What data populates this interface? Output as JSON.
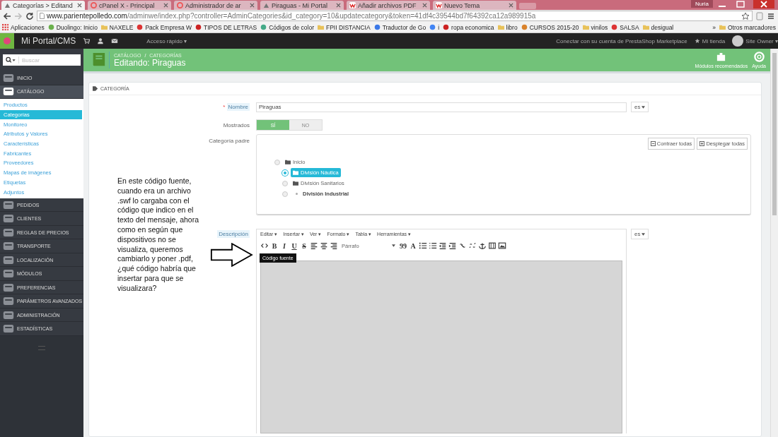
{
  "browser": {
    "tabs": [
      {
        "title": "Categorías > Editand",
        "selected": true,
        "kind": "store"
      },
      {
        "title": "cPanel X - Principal",
        "selected": false,
        "kind": "cpanel"
      },
      {
        "title": "Administrador de ar",
        "selected": false,
        "kind": "cpanel"
      },
      {
        "title": "Piraguas - Mi Portal",
        "selected": false,
        "kind": "store"
      },
      {
        "title": "Añadir archivos PDF",
        "selected": false,
        "kind": "w"
      },
      {
        "title": "Nuevo Tema",
        "selected": false,
        "kind": "w"
      }
    ],
    "user": "Nuria",
    "url_host": "www.parientepolledo.com",
    "url_path": "/adminwe/index.php?controller=AdminCategories&id_category=10&updatecategory&token=41df4c39544bd7f64392ca12a989915a",
    "bookmarks": [
      {
        "label": "Aplicaciones",
        "kind": "apps"
      },
      {
        "label": "Duolingo: Inicio",
        "kind": "green"
      },
      {
        "label": "NAXELE",
        "kind": "folder"
      },
      {
        "label": "Pack Empresa W",
        "kind": "w"
      },
      {
        "label": "TIPOS DE LETRAS",
        "kind": "red"
      },
      {
        "label": "Códigos de color",
        "kind": "wheel"
      },
      {
        "label": "FPII DISTANCIA",
        "kind": "folder"
      },
      {
        "label": "Traductor de Go",
        "kind": "blue"
      },
      {
        "label": "i",
        "kind": "g"
      },
      {
        "label": "ropa economica",
        "kind": "red"
      },
      {
        "label": "libro",
        "kind": "folder"
      },
      {
        "label": "CURSOS 2015-20",
        "kind": "orange"
      },
      {
        "label": "vinilos",
        "kind": "folder"
      },
      {
        "label": "SALSA",
        "kind": "w"
      },
      {
        "label": "desigual",
        "kind": "folder"
      }
    ],
    "more": "»",
    "other": "Otros marcadores"
  },
  "topbar": {
    "brand": "Mi Portal/CMS",
    "quick_access": "Acceso rápido ▾",
    "marketplace": "Conectar con su cuenta de PrestaShop Marketplace",
    "shop": "Mi tienda",
    "owner": "Site Owner ▾"
  },
  "sidebar": {
    "search_placeholder": "Buscar",
    "items": [
      {
        "label": "INICIO",
        "selected": false
      },
      {
        "label": "CATÁLOGO",
        "selected": true,
        "expanded": true,
        "children": [
          {
            "label": "Productos",
            "selected": false
          },
          {
            "label": "Categorías",
            "selected": true
          },
          {
            "label": "Monitoreo",
            "selected": false
          },
          {
            "label": "Atributos y Valores",
            "selected": false
          },
          {
            "label": "Características",
            "selected": false
          },
          {
            "label": "Fabricantes",
            "selected": false
          },
          {
            "label": "Proveedores",
            "selected": false
          },
          {
            "label": "Mapas de imágenes",
            "selected": false
          },
          {
            "label": "Etiquetas",
            "selected": false
          },
          {
            "label": "Adjuntos",
            "selected": false
          }
        ]
      },
      {
        "label": "PEDIDOS",
        "selected": false
      },
      {
        "label": "CLIENTES",
        "selected": false
      },
      {
        "label": "REGLAS DE PRECIOS",
        "selected": false
      },
      {
        "label": "TRANSPORTE",
        "selected": false
      },
      {
        "label": "LOCALIZACIÓN",
        "selected": false
      },
      {
        "label": "MÓDULOS",
        "selected": false
      },
      {
        "label": "PREFERENCIAS",
        "selected": false
      },
      {
        "label": "PARÁMETROS AVANZADOS",
        "selected": false
      },
      {
        "label": "ADMINISTRACIÓN",
        "selected": false
      },
      {
        "label": "ESTADÍSTICAS",
        "selected": false
      }
    ]
  },
  "header": {
    "breadcrumb": [
      "CATÁLOGO",
      "CATEGORÍAS"
    ],
    "separator": "/",
    "title": "Editando: Piraguas",
    "actions": [
      "Módulos recomendados",
      "Ayuda"
    ]
  },
  "panel": {
    "heading": "CATEGORÍA",
    "name": {
      "required_mark": "*",
      "label": "Nombre",
      "value": "Piraguas",
      "lang": "es"
    },
    "displayed": {
      "label": "Mostrados",
      "options": [
        {
          "label": "SÍ",
          "selected": true
        },
        {
          "label": "NO",
          "selected": false
        }
      ]
    },
    "parent": {
      "label": "Categoría padre",
      "buttons": [
        "Contraer todas",
        "Desplegar todas"
      ],
      "tree": [
        {
          "label": "Inicio",
          "selected": false,
          "kind": "folder-open",
          "children": [
            {
              "label": "División Náutica",
              "selected": true,
              "kind": "folder"
            },
            {
              "label": "División Sanitarios",
              "selected": false,
              "kind": "folder"
            },
            {
              "label": "División Industrial",
              "selected": false,
              "kind": "leaf"
            }
          ]
        }
      ]
    },
    "description": {
      "label": "Descripción",
      "lang": "es",
      "menu": [
        "Editar ▾",
        "Insertar ▾",
        "Ver ▾",
        "Formato ▾",
        "Tabla ▾",
        "Herramientas ▾"
      ],
      "toolbar": [
        {
          "kind": "code"
        },
        {
          "kind": "glyph",
          "label": "B"
        },
        {
          "kind": "glyph",
          "label": "I"
        },
        {
          "kind": "glyph",
          "label": "U"
        },
        {
          "kind": "glyph",
          "label": "S"
        },
        {
          "kind": "align-left"
        },
        {
          "kind": "align-center"
        },
        {
          "kind": "align-right"
        },
        {
          "kind": "select",
          "label": "Párrafo"
        },
        {
          "kind": "glyph",
          "label": "99"
        },
        {
          "kind": "glyph",
          "label": "A"
        },
        {
          "kind": "bullets"
        },
        {
          "kind": "numbers"
        },
        {
          "kind": "outdent"
        },
        {
          "kind": "indent"
        },
        {
          "kind": "link"
        },
        {
          "kind": "unlink"
        },
        {
          "kind": "anchor"
        },
        {
          "kind": "media"
        },
        {
          "kind": "image"
        }
      ],
      "tooltip": "Código fuente"
    }
  },
  "annotation": "En este código fuente, cuando era un archivo .swf lo cargaba con el código que indico en el texto del mensaje, ahora como en según que dispositivos no se visualiza, queremos cambiarlo y poner .pdf, ¿qué código habría que insertar para que se visualizara?"
}
